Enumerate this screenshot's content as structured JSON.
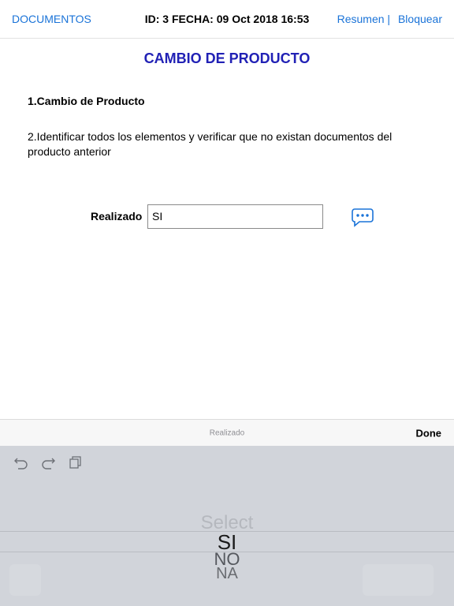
{
  "navbar": {
    "left_link": "DOCUMENTOS",
    "center_title": "ID: 3 FECHA: 09 Oct 2018 16:53",
    "right_link_1": "Resumen |",
    "right_link_2": "Bloquear"
  },
  "page": {
    "title": "CAMBIO DE PRODUCTO",
    "step1": "1.Cambio de Producto",
    "step2": "2.Identificar todos los elementos y verificar que no existan documentos del producto anterior"
  },
  "form": {
    "label": "Realizado",
    "value": "SI",
    "comment_icon": "chat-bubble-dots-icon"
  },
  "accessory_bar": {
    "title": "Realizado",
    "done_label": "Done"
  },
  "keyboard": {
    "tools": [
      "undo-icon",
      "redo-icon",
      "paste-icon"
    ],
    "picker": {
      "placeholder": "Select",
      "options": [
        "SI",
        "NO",
        "NA"
      ],
      "selected": "SI"
    }
  },
  "colors": {
    "link": "#1a73d8",
    "title": "#2121b5",
    "keyboard_bg": "#d1d4da"
  }
}
